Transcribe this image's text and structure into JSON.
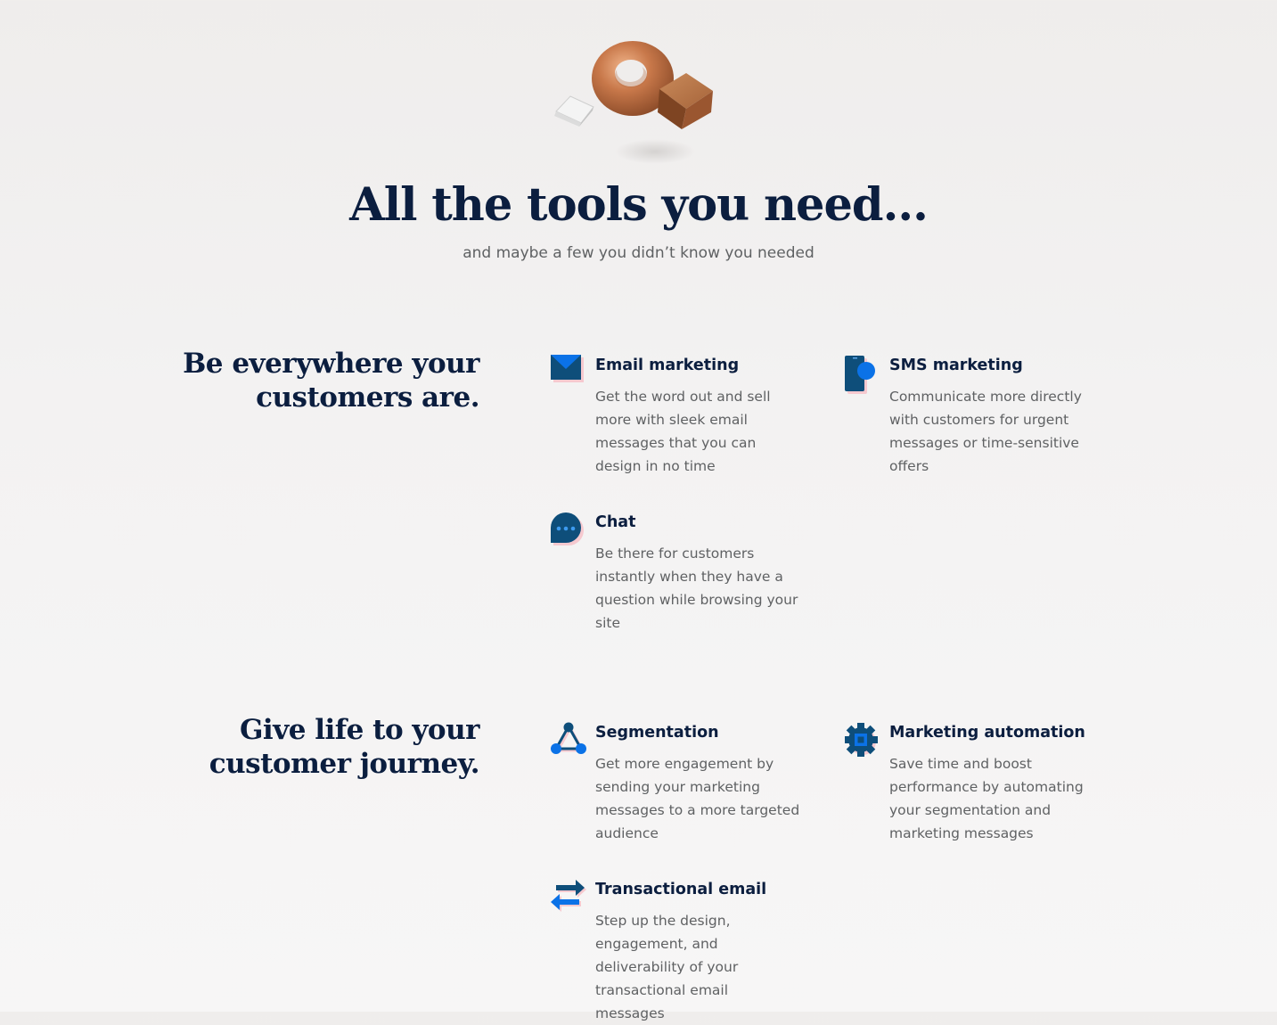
{
  "colors": {
    "navy": "#0b1e3f",
    "accent_blue": "#0b72e7",
    "dark_blue": "#0e4e7a",
    "body_gray": "#5f6163",
    "pink_shadow": "#f6c9cf"
  },
  "hero": {
    "title": "All the tools you need...",
    "subtitle": "and maybe a few you didn’t know you needed"
  },
  "sections": [
    {
      "title_line1": "Be everywhere your",
      "title_line2": "customers are.",
      "features": [
        {
          "icon": "envelope-icon",
          "title": "Email marketing",
          "description": "Get the word out and sell more with sleek email messages that you can design in no time"
        },
        {
          "icon": "phone-message-icon",
          "title": "SMS marketing",
          "description": "Communicate more directly with customers for urgent messages or time-sensitive offers"
        },
        {
          "icon": "chat-bubble-icon",
          "title": "Chat",
          "description": "Be there for customers instantly when they have a question while browsing your site"
        }
      ]
    },
    {
      "title_line1": "Give life to your",
      "title_line2": "customer journey.",
      "features": [
        {
          "icon": "segmentation-nodes-icon",
          "title": "Segmentation",
          "description": "Get more engagement by sending your marketing messages to a more targeted audience"
        },
        {
          "icon": "automation-gear-icon",
          "title": "Marketing automation",
          "description": "Save time and boost performance by automating your segmentation and marketing messages"
        },
        {
          "icon": "transfer-arrows-icon",
          "title": "Transactional email",
          "description": "Step up the design, engagement, and deliverability of your transactional email messages"
        }
      ]
    }
  ]
}
